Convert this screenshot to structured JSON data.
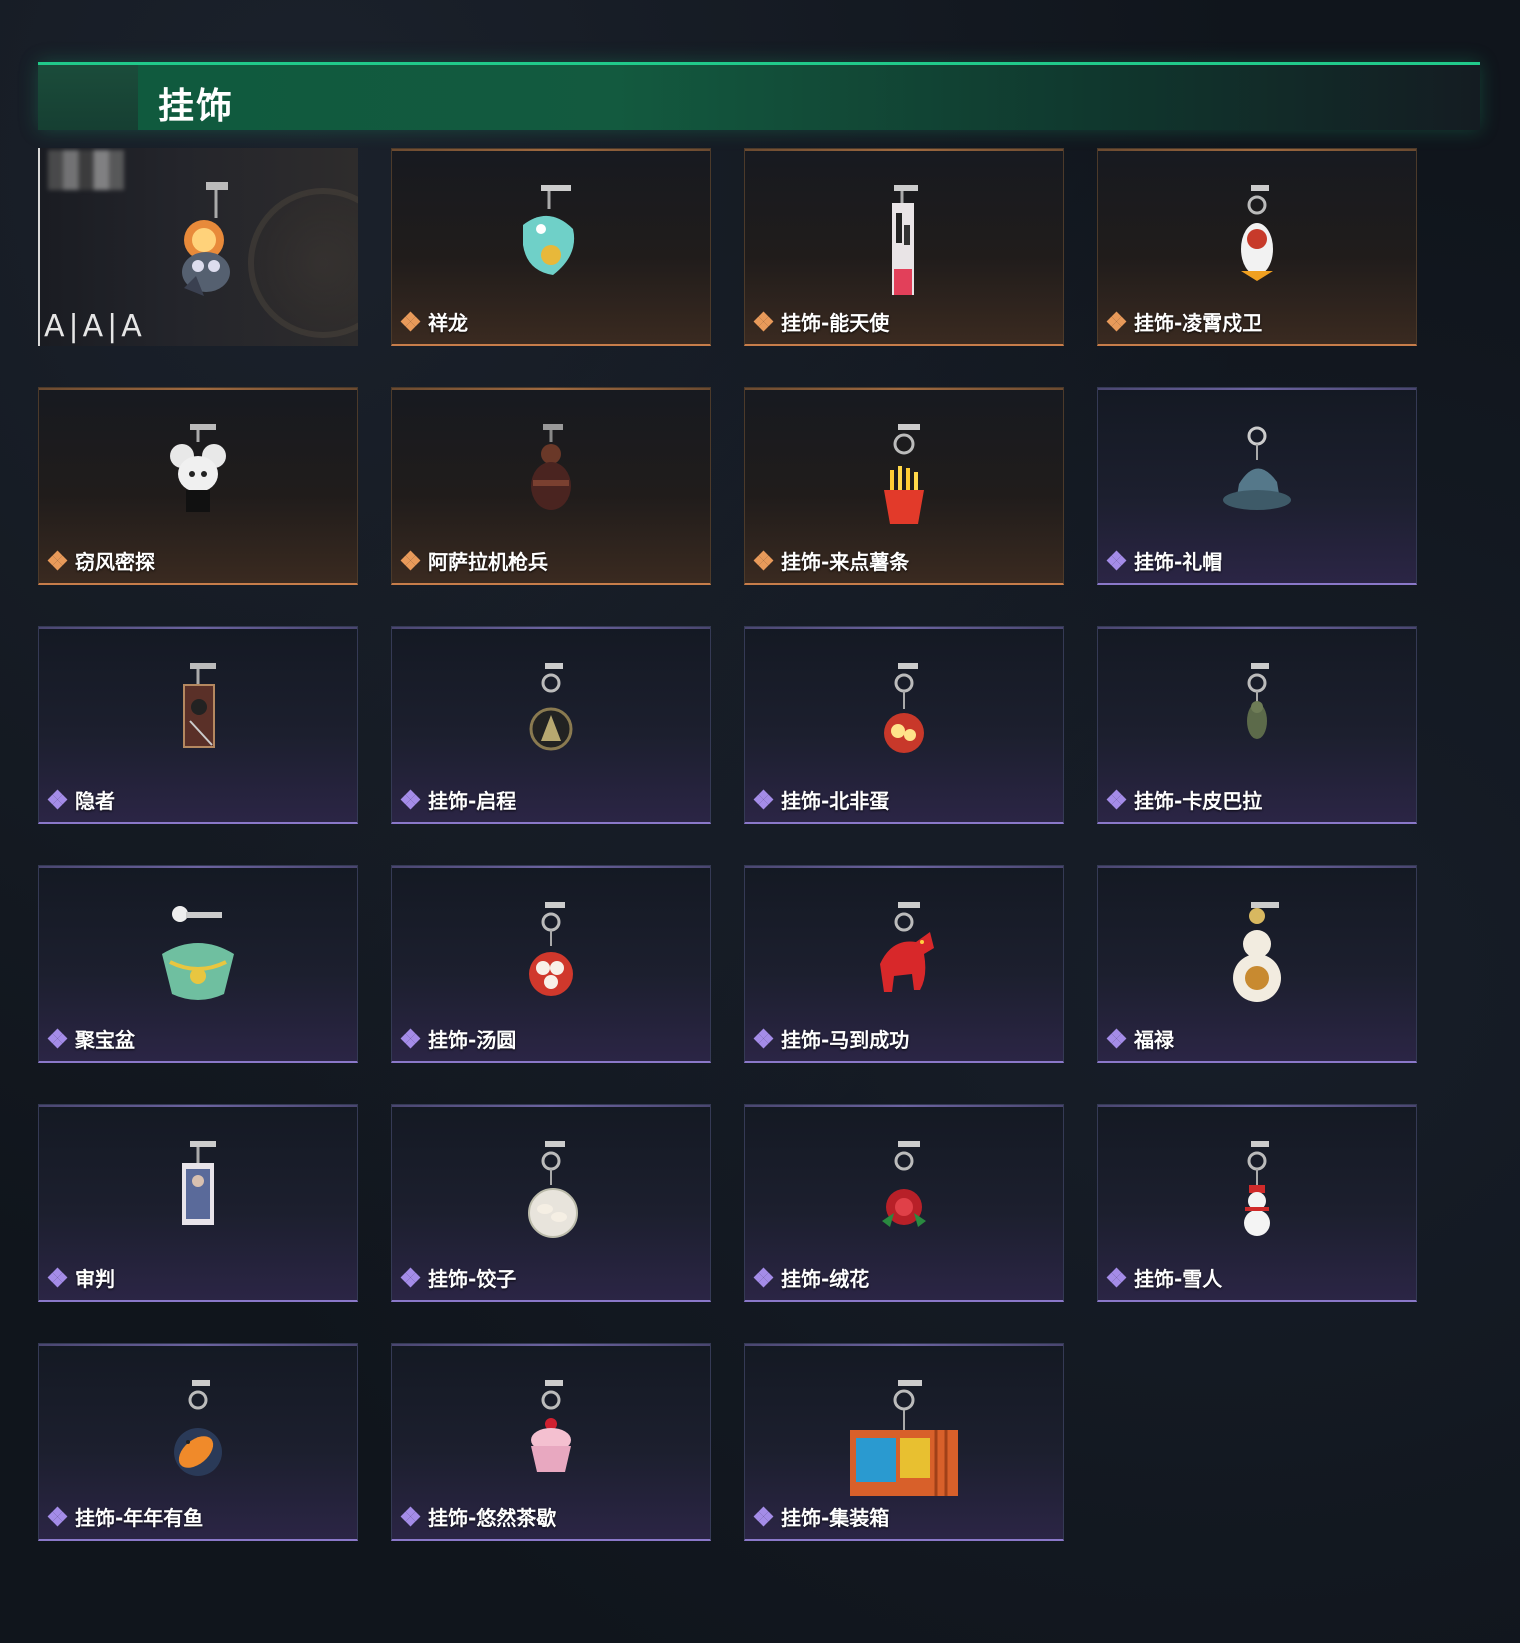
{
  "header": {
    "title": "挂饰"
  },
  "featured": {
    "logo_text": "A|A|A"
  },
  "colors": {
    "accent_green": "#21c98a",
    "gold_rarity": "#e89a5a",
    "purple_rarity": "#a48ce8"
  },
  "items": [
    {
      "label": "祥龙",
      "rarity": "gold",
      "icon": "dragon-charm-icon"
    },
    {
      "label": "挂饰-能天使",
      "rarity": "gold",
      "icon": "tag-charm-icon"
    },
    {
      "label": "挂饰-凌霄戍卫",
      "rarity": "gold",
      "icon": "penguin-charm-icon"
    },
    {
      "label": "窃风密探",
      "rarity": "gold",
      "icon": "mouse-charm-icon"
    },
    {
      "label": "阿萨拉机枪兵",
      "rarity": "gold",
      "icon": "soldier-charm-icon"
    },
    {
      "label": "挂饰-来点薯条",
      "rarity": "gold",
      "icon": "fries-charm-icon"
    },
    {
      "label": "挂饰-礼帽",
      "rarity": "purple",
      "icon": "hat-charm-icon"
    },
    {
      "label": "隐者",
      "rarity": "purple",
      "icon": "card-charm-icon"
    },
    {
      "label": "挂饰-启程",
      "rarity": "purple",
      "icon": "badge-charm-icon"
    },
    {
      "label": "挂饰-北非蛋",
      "rarity": "purple",
      "icon": "egg-dish-charm-icon"
    },
    {
      "label": "挂饰-卡皮巴拉",
      "rarity": "purple",
      "icon": "capybara-charm-icon"
    },
    {
      "label": "聚宝盆",
      "rarity": "purple",
      "icon": "treasure-bowl-charm-icon"
    },
    {
      "label": "挂饰-汤圆",
      "rarity": "purple",
      "icon": "tangyuan-charm-icon"
    },
    {
      "label": "挂饰-马到成功",
      "rarity": "purple",
      "icon": "horse-charm-icon"
    },
    {
      "label": "福禄",
      "rarity": "purple",
      "icon": "gourd-charm-icon"
    },
    {
      "label": "审判",
      "rarity": "purple",
      "icon": "judge-card-charm-icon"
    },
    {
      "label": "挂饰-饺子",
      "rarity": "purple",
      "icon": "dumpling-charm-icon"
    },
    {
      "label": "挂饰-绒花",
      "rarity": "purple",
      "icon": "flower-charm-icon"
    },
    {
      "label": "挂饰-雪人",
      "rarity": "purple",
      "icon": "snowman-charm-icon"
    },
    {
      "label": "挂饰-年年有鱼",
      "rarity": "purple",
      "icon": "fish-charm-icon"
    },
    {
      "label": "挂饰-悠然茶歇",
      "rarity": "purple",
      "icon": "cupcake-charm-icon"
    },
    {
      "label": "挂饰-集装箱",
      "rarity": "purple",
      "icon": "container-charm-icon"
    }
  ]
}
